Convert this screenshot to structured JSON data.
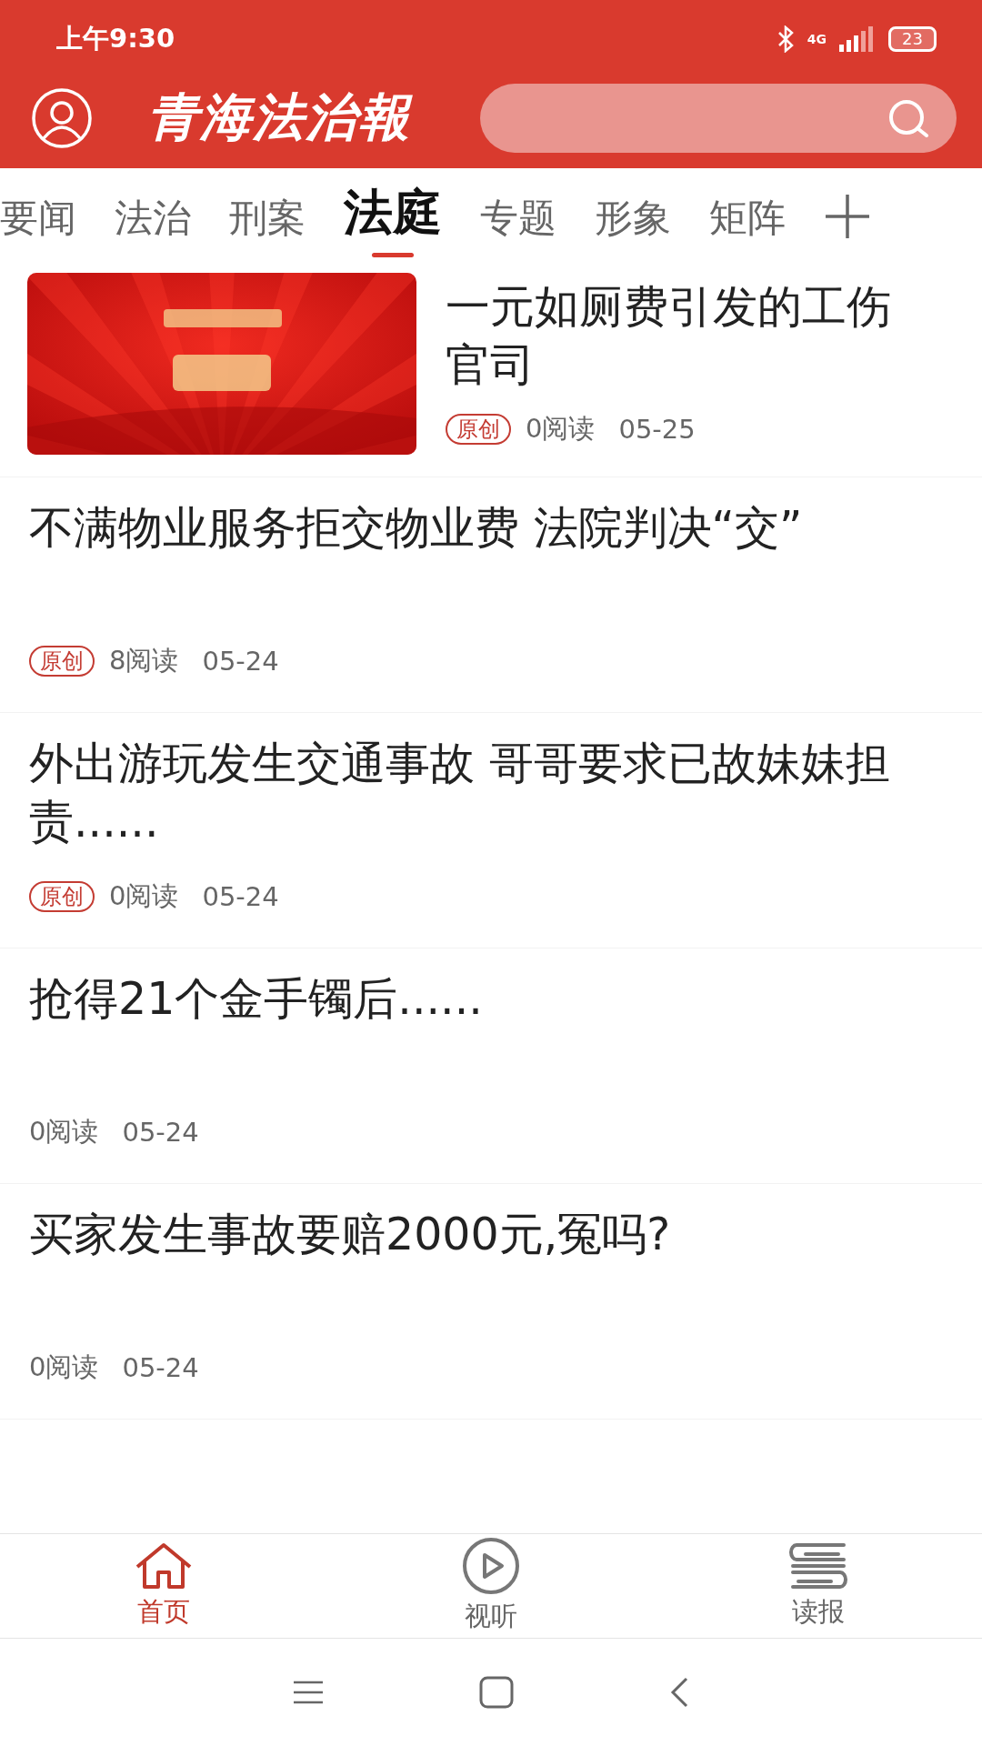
{
  "status_bar": {
    "time": "上午9:30",
    "network": "4G",
    "battery": "23"
  },
  "header": {
    "logo": "青海法治報"
  },
  "tabs": [
    {
      "label": "要闻",
      "selected": false
    },
    {
      "label": "法治",
      "selected": false
    },
    {
      "label": "刑案",
      "selected": false
    },
    {
      "label": "法庭",
      "selected": true
    },
    {
      "label": "专题",
      "selected": false
    },
    {
      "label": "形象",
      "selected": false
    },
    {
      "label": "矩阵",
      "selected": false
    }
  ],
  "articles": [
    {
      "kind": "thumbnail",
      "title": "一元如厕费引发的工伤官司",
      "badge": "原创",
      "reads": "0阅读",
      "date": "05-25"
    },
    {
      "kind": "text",
      "title": "不满物业服务拒交物业费 法院判决“交”",
      "badge": "原创",
      "reads": "8阅读",
      "date": "05-24"
    },
    {
      "kind": "text",
      "title": "外出游玩发生交通事故 哥哥要求已故妹妹担责......",
      "badge": "原创",
      "reads": "0阅读",
      "date": "05-24"
    },
    {
      "kind": "text",
      "title": "抢得21个金手镯后......",
      "reads": "0阅读",
      "date": "05-24"
    },
    {
      "kind": "text",
      "title": "买家发生事故要赔2000元,冤吗?",
      "reads": "0阅读",
      "date": "05-24"
    }
  ],
  "bottom_nav": [
    {
      "label": "首页",
      "kind": "home",
      "selected": true
    },
    {
      "label": "视听",
      "kind": "play",
      "selected": false
    },
    {
      "label": "读报",
      "kind": "paper",
      "selected": false
    }
  ]
}
